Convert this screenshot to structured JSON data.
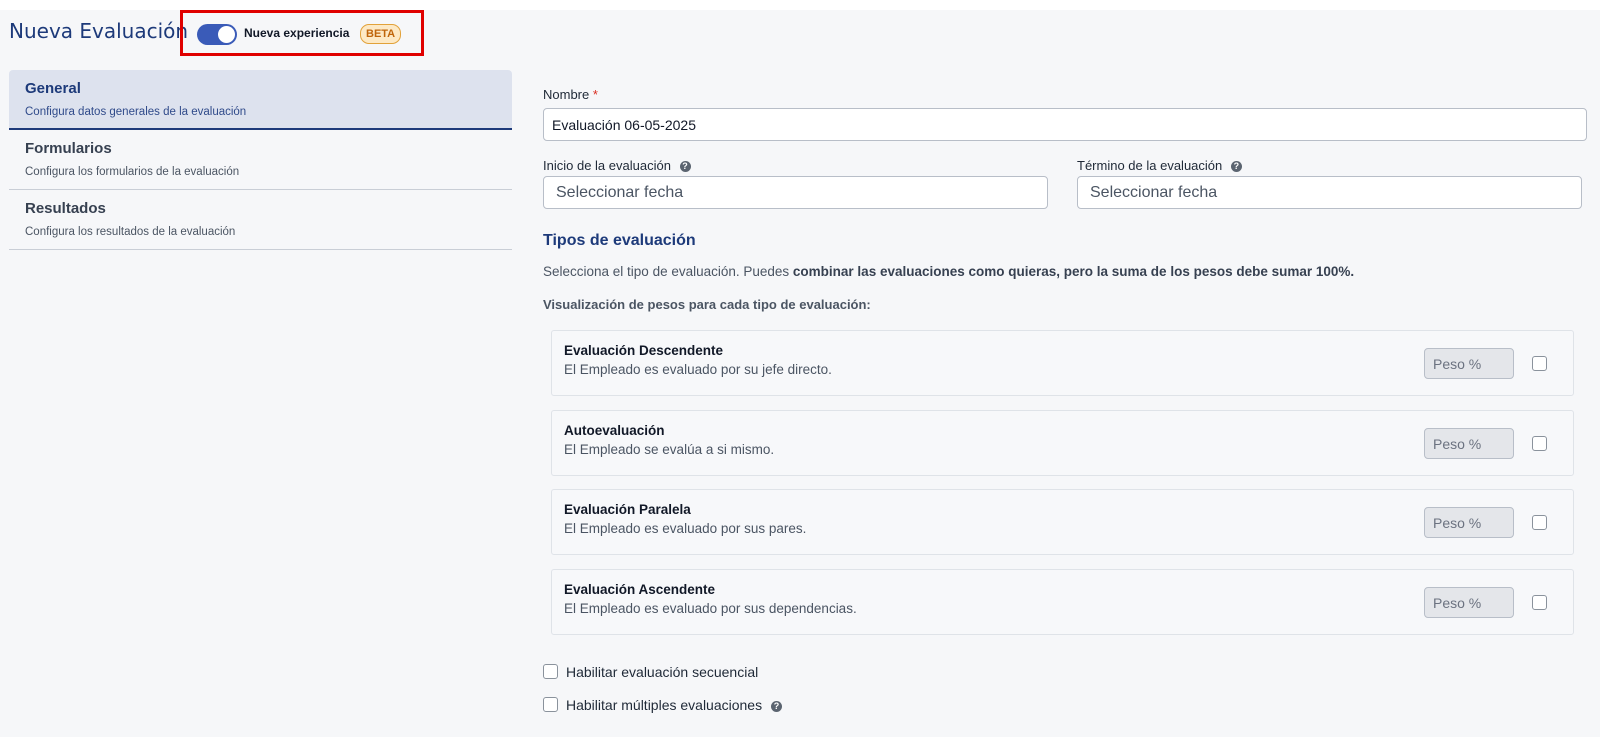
{
  "header": {
    "title": "Nueva Evaluación",
    "toggle_label": "Nueva experiencia",
    "badge": "BETA"
  },
  "sidebar": {
    "items": [
      {
        "title": "General",
        "subtitle": "Configura datos generales de la evaluación",
        "active": true
      },
      {
        "title": "Formularios",
        "subtitle": "Configura los formularios de la evaluación",
        "active": false
      },
      {
        "title": "Resultados",
        "subtitle": "Configura los resultados de la evaluación",
        "active": false
      }
    ]
  },
  "form": {
    "name_label": "Nombre",
    "name_required_mark": "*",
    "name_value": "Evaluación 06-05-2025",
    "start_label": "Inicio de la evaluación",
    "start_placeholder": "Seleccionar fecha",
    "end_label": "Término de la evaluación",
    "end_placeholder": "Seleccionar fecha"
  },
  "types": {
    "title": "Tipos de evaluación",
    "description_prefix": "Selecciona el tipo de evaluación. Puedes ",
    "description_bold": "combinar las evaluaciones como quieras, pero la suma de los pesos debe sumar 100%.",
    "weights_label": "Visualización de pesos para cada tipo de evaluación:",
    "weight_placeholder": "Peso %",
    "items": [
      {
        "title": "Evaluación Descendente",
        "description": "El Empleado es evaluado por su jefe directo."
      },
      {
        "title": "Autoevaluación",
        "description": "El Empleado se evalúa a si mismo."
      },
      {
        "title": "Evaluación Paralela",
        "description": "El Empleado es evaluado por sus pares."
      },
      {
        "title": "Evaluación Ascendente",
        "description": "El Empleado es evaluado por sus dependencias."
      }
    ]
  },
  "options": {
    "sequential_label": "Habilitar evaluación secuencial",
    "multiple_label": "Habilitar múltiples evaluaciones"
  },
  "icons": {
    "help": "help-circle-icon",
    "checkbox": "checkbox-icon"
  },
  "colors": {
    "brand": "#1d3a7a",
    "toggle_on": "#3a5bb8",
    "highlight": "#e00000",
    "badge_bg": "#fde9c5",
    "badge_text": "#c0650a",
    "required": "#d92d20"
  }
}
